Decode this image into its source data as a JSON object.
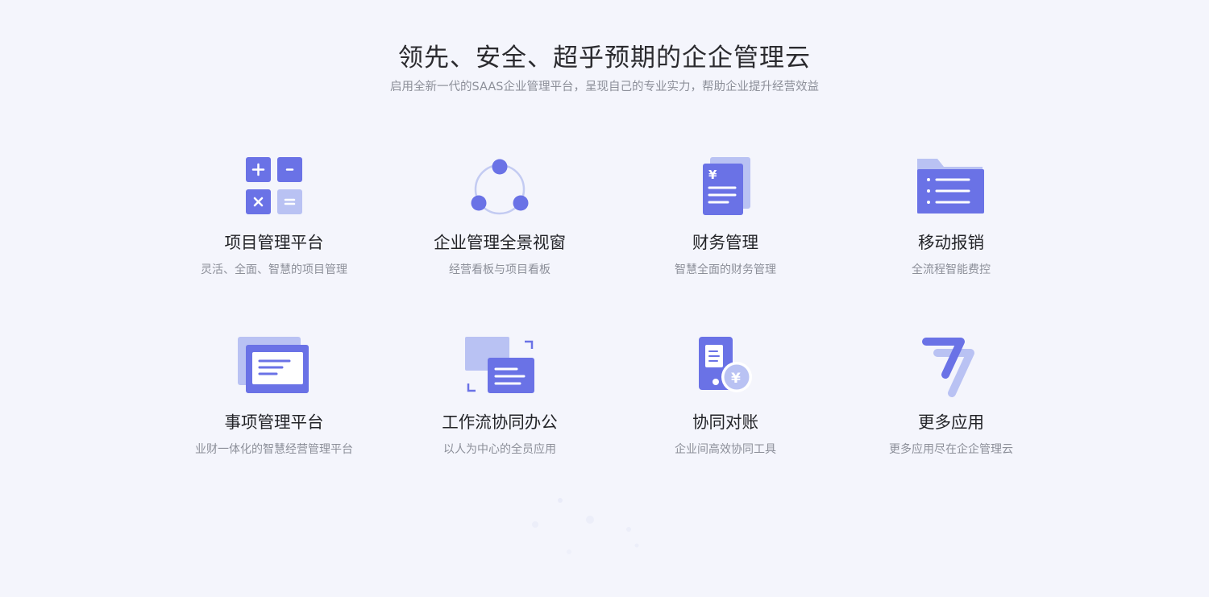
{
  "hero": {
    "title": "领先、安全、超乎预期的企企管理云",
    "subtitle": "启用全新一代的SAAS企业管理平台，呈现自己的专业实力，帮助企业提升经营效益"
  },
  "colors": {
    "primary": "#6a72e6",
    "light": "#b9c2f3",
    "background": "#f4f5fc"
  },
  "features": [
    {
      "icon": "calculator-icon",
      "title": "项目管理平台",
      "desc": "灵活、全面、智慧的项目管理"
    },
    {
      "icon": "network-icon",
      "title": "企业管理全景视窗",
      "desc": "经营看板与项目看板"
    },
    {
      "icon": "finance-document-icon",
      "title": "财务管理",
      "desc": "智慧全面的财务管理"
    },
    {
      "icon": "folder-list-icon",
      "title": "移动报销",
      "desc": "全流程智能费控"
    },
    {
      "icon": "card-stack-icon",
      "title": "事项管理平台",
      "desc": "业财一体化的智慧经营管理平台"
    },
    {
      "icon": "workflow-screen-icon",
      "title": "工作流协同办公",
      "desc": "以人为中心的全员应用"
    },
    {
      "icon": "mobile-payment-icon",
      "title": "协同对账",
      "desc": "企业间高效协同工具"
    },
    {
      "icon": "more-apps-icon",
      "title": "更多应用",
      "desc": "更多应用尽在企企管理云"
    }
  ]
}
